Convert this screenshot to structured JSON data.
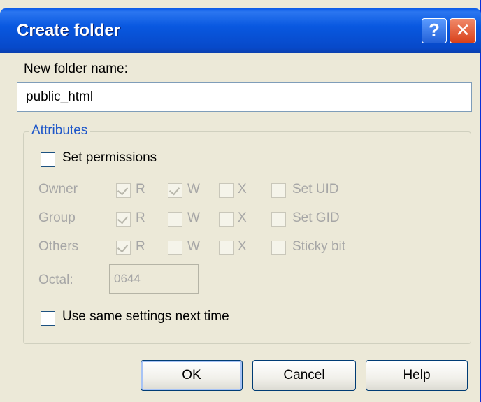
{
  "window": {
    "title": "Create folder",
    "help_button": "?",
    "close_button": "✕"
  },
  "name_field": {
    "label": "New folder name:",
    "value": "public_html"
  },
  "attributes": {
    "group_label": "Attributes",
    "set_permissions": {
      "label": "Set permissions",
      "checked": false
    },
    "rows": [
      {
        "label": "Owner",
        "r": {
          "label": "R",
          "checked": true
        },
        "w": {
          "label": "W",
          "checked": true
        },
        "x": {
          "label": "X",
          "checked": false
        },
        "special": {
          "label": "Set UID",
          "checked": false
        }
      },
      {
        "label": "Group",
        "r": {
          "label": "R",
          "checked": true
        },
        "w": {
          "label": "W",
          "checked": false
        },
        "x": {
          "label": "X",
          "checked": false
        },
        "special": {
          "label": "Set GID",
          "checked": false
        }
      },
      {
        "label": "Others",
        "r": {
          "label": "R",
          "checked": true
        },
        "w": {
          "label": "W",
          "checked": false
        },
        "x": {
          "label": "X",
          "checked": false
        },
        "special": {
          "label": "Sticky bit",
          "checked": false
        }
      }
    ],
    "octal": {
      "label": "Octal:",
      "value": "0644"
    },
    "use_same_settings": {
      "label": "Use same settings next time",
      "checked": false
    }
  },
  "buttons": {
    "ok": "OK",
    "cancel": "Cancel",
    "help": "Help"
  }
}
